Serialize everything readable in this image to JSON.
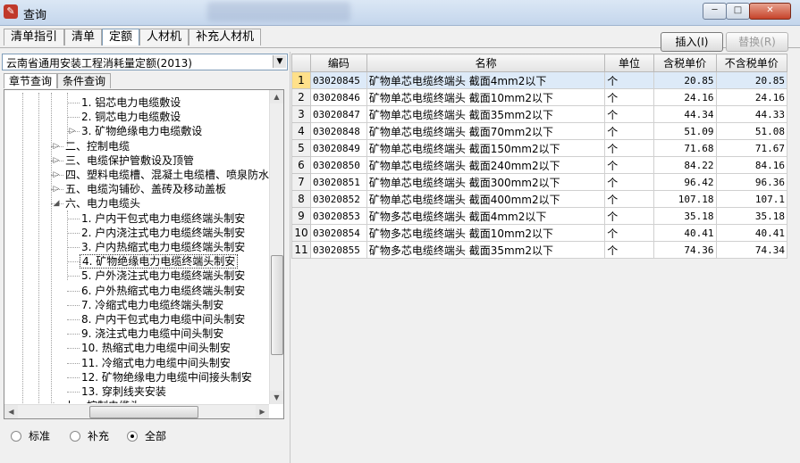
{
  "window": {
    "title": "查询",
    "app_icon": "app-logo-icon",
    "controls": {
      "minimize": "─",
      "maximize": "□",
      "close": "✕"
    }
  },
  "top_tabs": [
    {
      "label": "清单指引",
      "active": false
    },
    {
      "label": "清单",
      "active": false
    },
    {
      "label": "定额",
      "active": true
    },
    {
      "label": "人材机",
      "active": false
    },
    {
      "label": "补充人材机",
      "active": false
    }
  ],
  "toolbar": {
    "insert_label": "插入(I)",
    "replace_label": "替换(R)"
  },
  "quota_select": {
    "value": "云南省通用安装工程消耗量定额(2013)"
  },
  "left_tabs": [
    {
      "label": "章节查询",
      "active": true
    },
    {
      "label": "条件查询",
      "active": false
    }
  ],
  "tree": [
    {
      "label": "1. 铝芯电力电缆敷设",
      "level": 3,
      "expand": ""
    },
    {
      "label": "2. 铜芯电力电缆敷设",
      "level": 3,
      "expand": ""
    },
    {
      "label": "3. 矿物绝缘电力电缆敷设",
      "level": 3,
      "expand": "▷"
    },
    {
      "label": "二、控制电缆",
      "level": 2,
      "expand": "▷"
    },
    {
      "label": "三、电缆保护管敷设及顶管",
      "level": 2,
      "expand": "▷"
    },
    {
      "label": "四、塑料电缆槽、混凝土电缆槽、喷泉防水",
      "level": 2,
      "expand": "▷"
    },
    {
      "label": "五、电缆沟铺砂、盖砖及移动盖板",
      "level": 2,
      "expand": "▷"
    },
    {
      "label": "六、电力电缆头",
      "level": 2,
      "expand": "◢"
    },
    {
      "label": "1. 户内干包式电力电缆终端头制安",
      "level": 3,
      "expand": ""
    },
    {
      "label": "2. 户内浇注式电力电缆终端头制安",
      "level": 3,
      "expand": ""
    },
    {
      "label": "3. 户内热缩式电力电缆终端头制安",
      "level": 3,
      "expand": ""
    },
    {
      "label": "4. 矿物绝缘电力电缆终端头制安",
      "level": 3,
      "expand": "",
      "selected": true
    },
    {
      "label": "5. 户外浇注式电力电缆终端头制安",
      "level": 3,
      "expand": ""
    },
    {
      "label": "6. 户外热缩式电力电缆终端头制安",
      "level": 3,
      "expand": ""
    },
    {
      "label": "7. 冷缩式电力电缆终端头制安",
      "level": 3,
      "expand": ""
    },
    {
      "label": "8. 户内干包式电力电缆中间头制安",
      "level": 3,
      "expand": ""
    },
    {
      "label": "9. 浇注式电力电缆中间头制安",
      "level": 3,
      "expand": ""
    },
    {
      "label": "10. 热缩式电力电缆中间头制安",
      "level": 3,
      "expand": ""
    },
    {
      "label": "11. 冷缩式电力电缆中间头制安",
      "level": 3,
      "expand": ""
    },
    {
      "label": "12. 矿物绝缘电力电缆中间接头制安",
      "level": 3,
      "expand": ""
    },
    {
      "label": "13. 穿刺线夹安装",
      "level": 3,
      "expand": ""
    },
    {
      "label": "七、控制电缆头",
      "level": 2,
      "expand": "▷"
    }
  ],
  "radio_options": [
    {
      "label": "标准",
      "checked": false
    },
    {
      "label": "补充",
      "checked": false
    },
    {
      "label": "全部",
      "checked": true
    }
  ],
  "grid": {
    "columns": [
      "",
      "编码",
      "名称",
      "单位",
      "含税单价",
      "不含税单价"
    ],
    "rows": [
      [
        "1",
        "03020845",
        "矿物单芯电缆终端头 截面4mm2以下",
        "个",
        "20.85",
        "20.85"
      ],
      [
        "2",
        "03020846",
        "矿物单芯电缆终端头 截面10mm2以下",
        "个",
        "24.16",
        "24.16"
      ],
      [
        "3",
        "03020847",
        "矿物单芯电缆终端头 截面35mm2以下",
        "个",
        "44.34",
        "44.33"
      ],
      [
        "4",
        "03020848",
        "矿物单芯电缆终端头 截面70mm2以下",
        "个",
        "51.09",
        "51.08"
      ],
      [
        "5",
        "03020849",
        "矿物单芯电缆终端头 截面150mm2以下",
        "个",
        "71.68",
        "71.67"
      ],
      [
        "6",
        "03020850",
        "矿物单芯电缆终端头 截面240mm2以下",
        "个",
        "84.22",
        "84.16"
      ],
      [
        "7",
        "03020851",
        "矿物单芯电缆终端头 截面300mm2以下",
        "个",
        "96.42",
        "96.36"
      ],
      [
        "8",
        "03020852",
        "矿物单芯电缆终端头 截面400mm2以下",
        "个",
        "107.18",
        "107.1"
      ],
      [
        "9",
        "03020853",
        "矿物多芯电缆终端头 截面4mm2以下",
        "个",
        "35.18",
        "35.18"
      ],
      [
        "10",
        "03020854",
        "矿物多芯电缆终端头 截面10mm2以下",
        "个",
        "40.41",
        "40.41"
      ],
      [
        "11",
        "03020855",
        "矿物多芯电缆终端头 截面35mm2以下",
        "个",
        "74.36",
        "74.34"
      ]
    ],
    "selected_row": 0
  }
}
